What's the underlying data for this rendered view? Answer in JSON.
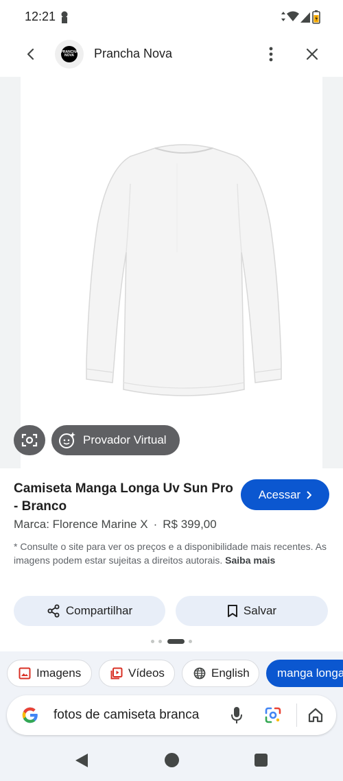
{
  "status_bar": {
    "time": "12:21"
  },
  "header": {
    "site_name": "Prancha Nova",
    "logo_text": "PRANCHA NOVA"
  },
  "image_viewer": {
    "virtual_tryon_label": "Provador Virtual"
  },
  "product": {
    "title": "Camiseta Manga Longa Uv Sun Pro - Branco",
    "access_label": "Acessar",
    "brand": "Marca: Florence Marine X",
    "separator": "·",
    "price": "R$ 399,00",
    "disclaimer": "* Consulte o site para ver os preços e a disponibilidade mais recentes. As imagens podem estar sujeitas a direitos autorais.",
    "learn_more": "Saiba mais"
  },
  "actions": {
    "share_label": "Compartilhar",
    "save_label": "Salvar"
  },
  "pager": {
    "page_count": 4,
    "active_index": 2
  },
  "chips": {
    "images": "Imagens",
    "videos": "Vídeos",
    "english": "English",
    "query": "manga longa"
  },
  "search": {
    "query": "fotos de camiseta branca"
  },
  "colors": {
    "accent": "#0b57d0",
    "chip_bg": "#e8eef8",
    "overlay_button": "#5f6063"
  },
  "icons": {
    "status": [
      "lock-icon",
      "data-arrows-icon",
      "wifi-icon",
      "signal-icon",
      "battery-icon"
    ],
    "header": [
      "back-arrow-icon",
      "more-vert-icon",
      "close-icon"
    ],
    "chips": [
      "image-icon",
      "video-icon",
      "globe-icon"
    ],
    "search": [
      "google-logo-icon",
      "mic-icon",
      "lens-icon",
      "home-icon"
    ]
  }
}
